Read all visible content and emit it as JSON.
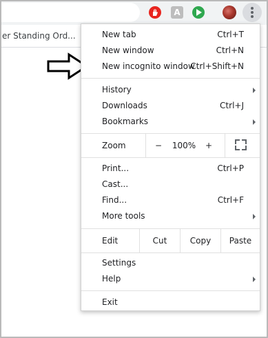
{
  "bookmarks": {
    "item": "er Standing Ord..."
  },
  "extensions": {
    "gray_badge": "A"
  },
  "menu": {
    "group1": [
      {
        "label": "New tab",
        "shortcut": "Ctrl+T"
      },
      {
        "label": "New window",
        "shortcut": "Ctrl+N"
      },
      {
        "label": "New incognito window",
        "shortcut": "Ctrl+Shift+N"
      }
    ],
    "group2": [
      {
        "label": "History",
        "shortcut": ""
      },
      {
        "label": "Downloads",
        "shortcut": "Ctrl+J"
      },
      {
        "label": "Bookmarks",
        "shortcut": ""
      }
    ],
    "zoom": {
      "label": "Zoom",
      "minus": "−",
      "value": "100%",
      "plus": "+"
    },
    "group3": [
      {
        "label": "Print...",
        "shortcut": "Ctrl+P"
      },
      {
        "label": "Cast...",
        "shortcut": ""
      },
      {
        "label": "Find...",
        "shortcut": "Ctrl+F"
      },
      {
        "label": "More tools",
        "shortcut": ""
      }
    ],
    "edit": {
      "label": "Edit",
      "cut": "Cut",
      "copy": "Copy",
      "paste": "Paste"
    },
    "group4": [
      {
        "label": "Settings",
        "shortcut": ""
      },
      {
        "label": "Help",
        "shortcut": ""
      }
    ],
    "exit": {
      "label": "Exit"
    }
  },
  "icons": {
    "ext_red": "hand-stop-icon",
    "ext_gray": "letter-a-icon",
    "ext_green": "play-icon",
    "avatar": "user-avatar",
    "menu": "three-dots-icon",
    "arrow": "right-arrow-icon",
    "fullscreen": "fullscreen-icon",
    "submenu": "chevron-right-icon"
  },
  "colors": {
    "toolbar": "#f1f3f4",
    "menu_bg": "#ffffff",
    "separator": "#e0e0e0",
    "ext_red": "#e8251f",
    "ext_green": "#2fa84f",
    "text": "#202124"
  }
}
